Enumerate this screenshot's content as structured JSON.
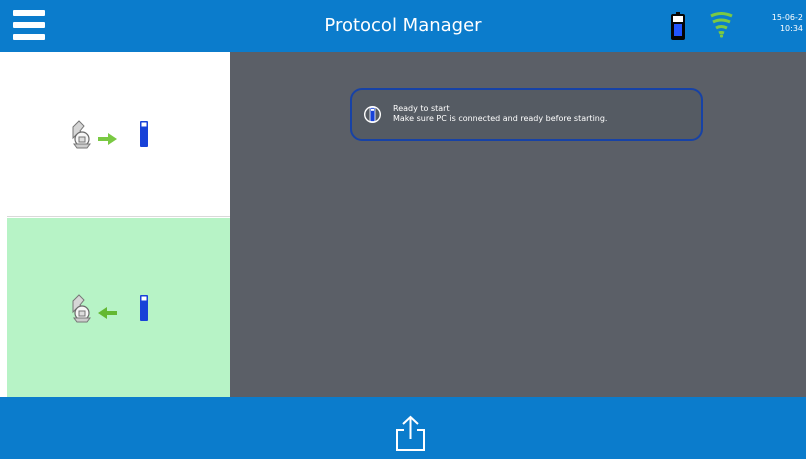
{
  "header": {
    "title": "Protocol Manager",
    "date": "15-06-2",
    "time": "10:34",
    "icons": {
      "menu": "hamburger-menu-icon",
      "device": "device-status-icon",
      "wifi": "wifi-signal-icon"
    }
  },
  "left_panel": {
    "tiles": [
      {
        "icon": "computer-to-device-transfer-icon",
        "state": "normal"
      },
      {
        "icon": "device-to-computer-transfer-icon",
        "state": "selected"
      }
    ]
  },
  "notification": {
    "icon": "device-info-icon",
    "line1": "Ready to start",
    "line2": "Make sure PC is connected and ready before starting."
  },
  "footer": {
    "action_icon": "export-share-icon"
  },
  "colors": {
    "header": "#0b7ccc",
    "main_background": "#5b5f67",
    "selected_tile": "#b7f3c6",
    "notification_border": "#1742a6",
    "accent_green": "#7ac943",
    "device_blue": "#1842d8"
  }
}
